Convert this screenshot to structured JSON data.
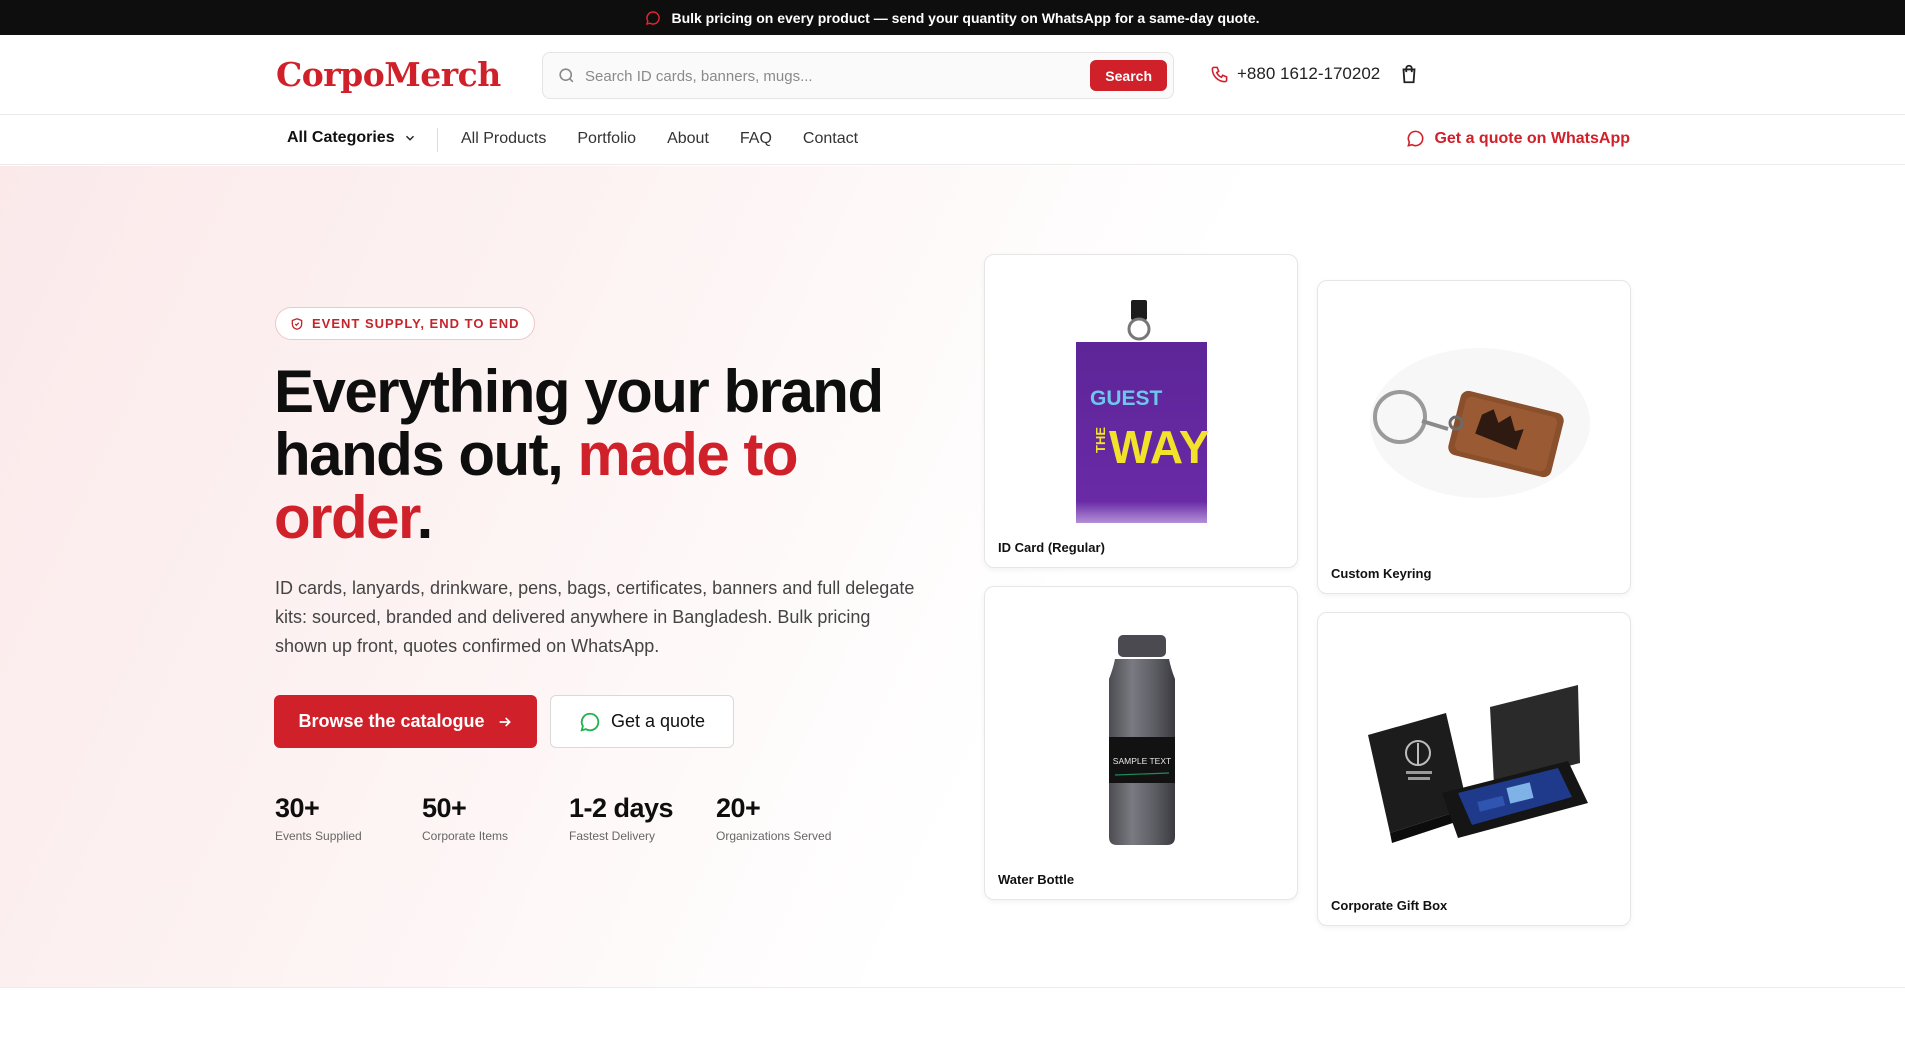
{
  "announcement": {
    "text": "Bulk pricing on every product — send your quantity on WhatsApp for a same-day quote."
  },
  "header": {
    "logo": "CorpoMerch",
    "search": {
      "placeholder": "Search ID cards, banners, mugs...",
      "button_label": "Search"
    },
    "phone": "+880 1612-170202"
  },
  "nav": {
    "categories_label": "All Categories",
    "links": [
      "All Products",
      "Portfolio",
      "About",
      "FAQ",
      "Contact"
    ],
    "whatsapp_label": "Get a quote on WhatsApp"
  },
  "hero": {
    "badge": "EVENT SUPPLY, END TO END",
    "headline_part1": "Everything your brand hands out,",
    "headline_accent": "made to order",
    "headline_end": ".",
    "description": "ID cards, lanyards, drinkware, pens, bags, certificates, banners and full delegate kits: sourced, branded and delivered anywhere in Bangladesh. Bulk pricing shown up front, quotes confirmed on WhatsApp.",
    "primary_button": "Browse the catalogue",
    "secondary_button": "Get a quote",
    "stats": [
      {
        "value": "30+",
        "label": "Events Supplied"
      },
      {
        "value": "50+",
        "label": "Corporate Items"
      },
      {
        "value": "1-2 days",
        "label": "Fastest Delivery"
      },
      {
        "value": "20+",
        "label": "Organizations Served"
      }
    ]
  },
  "products": [
    {
      "name": "ID Card (Regular)",
      "image_text_1": "GUEST",
      "image_text_2": "THE",
      "image_text_3": "WAY"
    },
    {
      "name": "Custom Keyring"
    },
    {
      "name": "Water Bottle",
      "image_text_1": "SAMPLE TEXT"
    },
    {
      "name": "Corporate Gift Box"
    }
  ],
  "colors": {
    "brand": "#d0202a",
    "topbar": "#0e0e0e",
    "whatsapp": "#22b14c"
  }
}
